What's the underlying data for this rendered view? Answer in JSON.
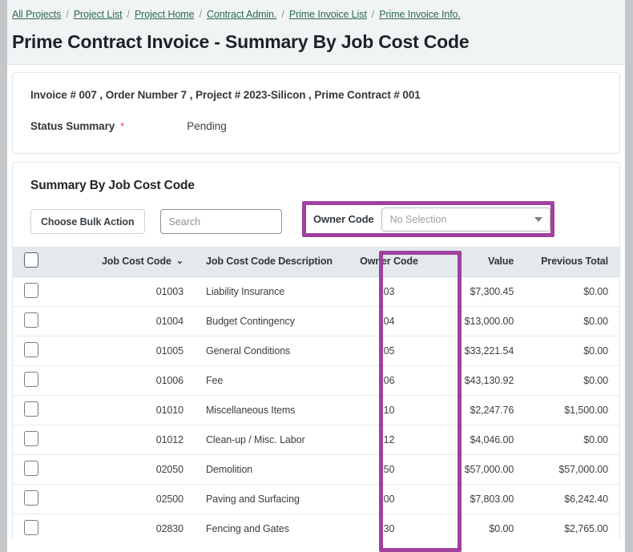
{
  "breadcrumb": {
    "items": [
      {
        "label": "All Projects"
      },
      {
        "label": "Project List"
      },
      {
        "label": "Project Home"
      },
      {
        "label": "Contract Admin."
      },
      {
        "label": "Prime Invoice List"
      },
      {
        "label": "Prime Invoice Info."
      }
    ],
    "separator": "/"
  },
  "page_title": "Prime Contract Invoice - Summary By Job Cost Code",
  "info": {
    "summary_line": "Invoice # 007 , Order Number 7 , Project # 2023-Silicon , Prime Contract # 001",
    "status_label": "Status Summary",
    "required_marker": "*",
    "status_value": "Pending"
  },
  "section": {
    "title": "Summary By Job Cost Code"
  },
  "toolbar": {
    "bulk_action_label": "Choose Bulk Action",
    "search_placeholder": "Search",
    "search_value": "",
    "owner_filter_label": "Owner Code",
    "owner_filter_value": "No Selection",
    "caret_icon": "chevron-down-icon"
  },
  "table": {
    "columns": [
      {
        "key": "check",
        "label": ""
      },
      {
        "key": "code",
        "label": "Job Cost Code",
        "sort_icon": "chevron-down-icon",
        "sort_caret": "⌄"
      },
      {
        "key": "desc",
        "label": "Job Cost Code Description"
      },
      {
        "key": "owner",
        "label": "Owner Code"
      },
      {
        "key": "value",
        "label": "Value"
      },
      {
        "key": "prev",
        "label": "Previous Total"
      }
    ],
    "rows": [
      {
        "code": "01003",
        "desc": "Liability Insurance",
        "owner": "03",
        "value": "$7,300.45",
        "prev": "$0.00"
      },
      {
        "code": "01004",
        "desc": "Budget Contingency",
        "owner": "04",
        "value": "$13,000.00",
        "prev": "$0.00"
      },
      {
        "code": "01005",
        "desc": "General Conditions",
        "owner": "05",
        "value": "$33,221.54",
        "prev": "$0.00"
      },
      {
        "code": "01006",
        "desc": "Fee",
        "owner": "06",
        "value": "$43,130.92",
        "prev": "$0.00"
      },
      {
        "code": "01010",
        "desc": "Miscellaneous Items",
        "owner": "10",
        "value": "$2,247.76",
        "prev": "$1,500.00"
      },
      {
        "code": "01012",
        "desc": "Clean-up / Misc. Labor",
        "owner": "12",
        "value": "$4,046.00",
        "prev": "$0.00"
      },
      {
        "code": "02050",
        "desc": "Demolition",
        "owner": "50",
        "value": "$57,000.00",
        "prev": "$57,000.00"
      },
      {
        "code": "02500",
        "desc": "Paving and Surfacing",
        "owner": "00",
        "value": "$7,803.00",
        "prev": "$6,242.40"
      },
      {
        "code": "02830",
        "desc": "Fencing and Gates",
        "owner": "30",
        "value": "$0.00",
        "prev": "$2,765.00"
      }
    ]
  },
  "annotation": {
    "highlight_color": "#a0419f",
    "targets": [
      "owner-code-filter",
      "owner-code-column"
    ]
  },
  "colors": {
    "link": "#2d6a4a",
    "header_band": "#f1f4f5",
    "table_header": "#e4e9ec",
    "required": "#d6455c"
  }
}
